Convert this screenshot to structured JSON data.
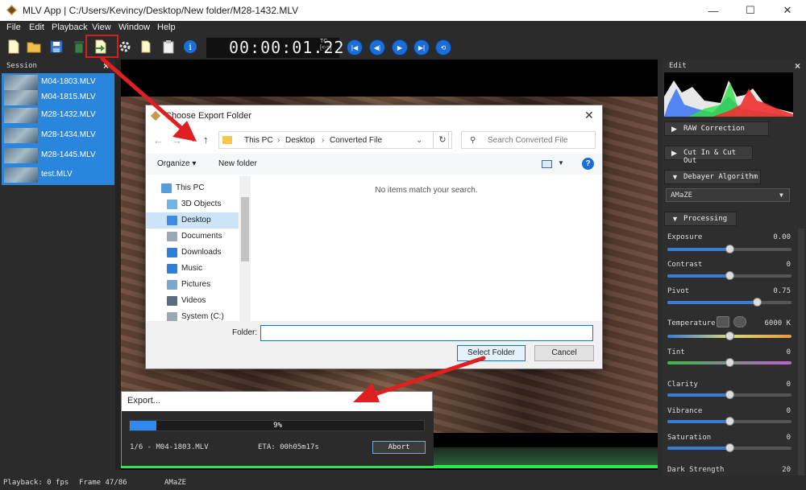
{
  "window": {
    "title": "MLV App | C:/Users/Kevincy/Desktop/New folder/M28-1432.MLV",
    "minimize_icon": "minimize-icon",
    "maximize_icon": "maximize-icon",
    "close_icon": "close-icon"
  },
  "menu": [
    "File",
    "Edit",
    "Playback",
    "View",
    "Window",
    "Help"
  ],
  "toolbar": {
    "icons": [
      "new-session-icon",
      "open-folder-icon",
      "save-icon",
      "delete-icon",
      "export-icon",
      "settings-icon",
      "clipboard-copy-icon",
      "clipboard-paste-icon",
      "info-icon"
    ],
    "timecode": "00:00:01.22",
    "tc_label": "TC",
    "tc_sub": "[<->]",
    "playback_icons": [
      "skip-start-icon",
      "step-back-icon",
      "play-icon",
      "step-forward-icon",
      "loop-icon"
    ]
  },
  "session": {
    "title": "Session",
    "close": "×",
    "items": [
      "M04-1803.MLV",
      "M04-1815.MLV",
      "M28-1432.MLV",
      "M28-1434.MLV",
      "M28-1445.MLV",
      "test.MLV"
    ]
  },
  "edit": {
    "title": "Edit",
    "close": "×",
    "sections": {
      "raw_correction": "RAW Correction",
      "cut_in_out": "Cut In & Cut Out",
      "debayer": "Debayer Algorithm",
      "processing": "Processing"
    },
    "debayer_value": "AMaZE",
    "params": [
      {
        "label": "Exposure",
        "value": "0.00",
        "level": 0.5
      },
      {
        "label": "Contrast",
        "value": "0",
        "level": 0.5
      },
      {
        "label": "Pivot",
        "value": "0.75",
        "level": 0.72
      },
      {
        "label": "Temperature",
        "value": "6000 K",
        "level": 0.5
      },
      {
        "label": "Tint",
        "value": "0",
        "level": 0.5
      },
      {
        "label": "Clarity",
        "value": "0",
        "level": 0.5
      },
      {
        "label": "Vibrance",
        "value": "0",
        "level": 0.5
      },
      {
        "label": "Saturation",
        "value": "0",
        "level": 0.5
      },
      {
        "label": "Dark Strength",
        "value": "20",
        "level": 0.2
      }
    ]
  },
  "file_dialog": {
    "title": "Choose Export Folder",
    "breadcrumb": [
      "This PC",
      "Desktop",
      "Converted File"
    ],
    "search_placeholder": "Search Converted File",
    "organize": "Organize ▾",
    "new_folder": "New folder",
    "nav": [
      {
        "label": "This PC",
        "icon": "computer-icon",
        "color": "#5b9bd5"
      },
      {
        "label": "3D Objects",
        "icon": "cube-icon",
        "color": "#6fb5e8"
      },
      {
        "label": "Desktop",
        "icon": "desktop-icon",
        "color": "#3b8be0"
      },
      {
        "label": "Documents",
        "icon": "document-icon",
        "color": "#9aa7b4"
      },
      {
        "label": "Downloads",
        "icon": "download-icon",
        "color": "#2f7fd6"
      },
      {
        "label": "Music",
        "icon": "music-icon",
        "color": "#2f7fd6"
      },
      {
        "label": "Pictures",
        "icon": "picture-icon",
        "color": "#7aa6cf"
      },
      {
        "label": "Videos",
        "icon": "video-icon",
        "color": "#5a6d80"
      },
      {
        "label": "System (C:)",
        "icon": "drive-icon",
        "color": "#9aa7b4"
      }
    ],
    "empty_message": "No items match your search.",
    "folder_label": "Folder:",
    "folder_value": "",
    "select_button": "Select Folder",
    "cancel_button": "Cancel"
  },
  "export_dialog": {
    "title": "Export...",
    "progress_percent": 9,
    "progress_text": "9%",
    "file_info": "1/6 - M04-1803.MLV",
    "eta": "ETA: 00h05m17s",
    "abort": "Abort"
  },
  "status": {
    "playback": "Playback: 0 fps",
    "frame": "Frame 47/86",
    "debayer": "AMaZE"
  }
}
